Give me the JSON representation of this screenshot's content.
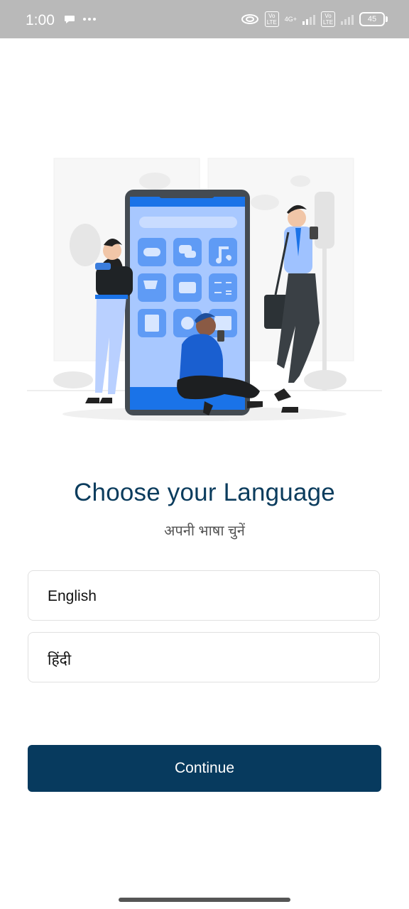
{
  "status_bar": {
    "time": "1:00",
    "network": "4G+",
    "volte_1": "Vo LTE",
    "volte_2": "Vo LTE",
    "battery": "45",
    "icons": [
      "chat-bubble-icon",
      "more-dots-icon",
      "hotspot-icon",
      "volte-icon",
      "signal-icon",
      "battery-icon"
    ]
  },
  "illustration": {
    "description_icon": "people-with-phones-illustration",
    "accent_color": "#1a73e8"
  },
  "heading": {
    "title": "Choose your Language",
    "subtitle": "अपनी भाषा चुनें"
  },
  "languages": [
    {
      "label": "English"
    },
    {
      "label": "हिंदी"
    }
  ],
  "actions": {
    "continue_label": "Continue",
    "continue_color": "#073a5e"
  }
}
